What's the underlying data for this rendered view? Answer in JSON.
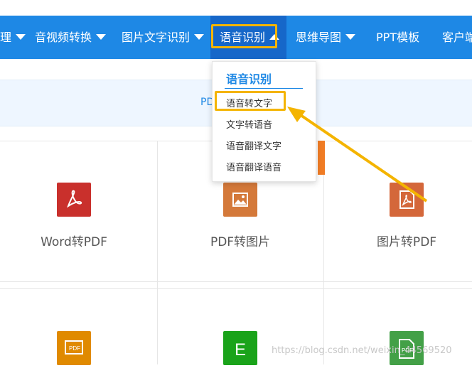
{
  "nav": {
    "items": [
      {
        "label": "理",
        "caret": "down"
      },
      {
        "label": "音视频转换",
        "caret": "down"
      },
      {
        "label": "图片文字识别",
        "caret": "down"
      },
      {
        "label": "语音识别",
        "caret": "up"
      },
      {
        "label": "思维导图",
        "caret": "down"
      },
      {
        "label": "PPT模板",
        "caret": "none"
      },
      {
        "label": "客户端",
        "caret": "none"
      }
    ]
  },
  "subbar": {
    "text": "PD"
  },
  "dropdown": {
    "title": "语音识别",
    "items": [
      "语音转文字",
      "文字转语音",
      "语音翻译文字",
      "语音翻译语音"
    ]
  },
  "cards": [
    {
      "label": "Word转PDF",
      "icon": "pdf-acrobat-icon",
      "color": "#c9302c"
    },
    {
      "label": "PDF转图片",
      "icon": "image-icon",
      "color": "#d4793a"
    },
    {
      "label": "图片转PDF",
      "icon": "pdf-file-icon",
      "color": "#d4673a"
    },
    {
      "label": "",
      "icon": "pdf-ppt-icon",
      "color": "#e08a00"
    },
    {
      "label": "",
      "icon": "excel-icon",
      "color": "#1aa31a"
    },
    {
      "label": "",
      "icon": "pdf-doc-icon",
      "color": "#43a047"
    }
  ],
  "watermark": "https://blog.csdn.net/weixin_44569520",
  "colors": {
    "nav": "#1e88e5",
    "highlight": "#f4b400",
    "accent": "#1e88e5"
  }
}
